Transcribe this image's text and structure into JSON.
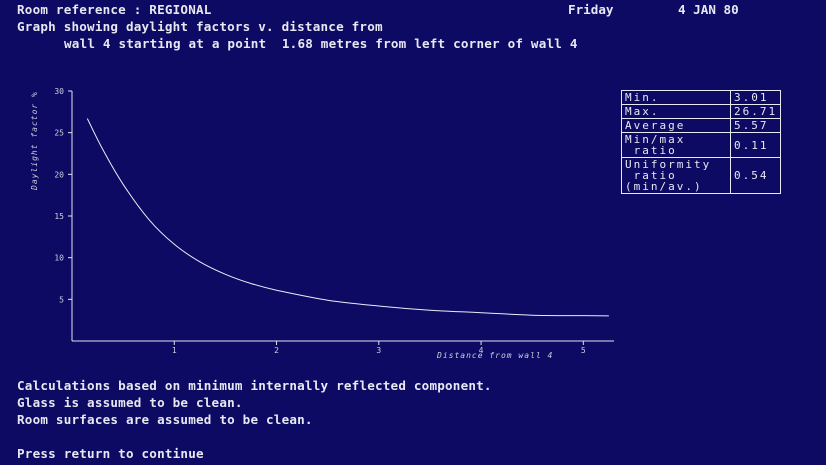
{
  "header": {
    "room_reference": "Room reference : REGIONAL",
    "day": "Friday",
    "date": "4 JAN 80",
    "line2": "Graph showing daylight factors v. distance from",
    "line3": "wall 4 starting at a point  1.68 metres from left corner of wall 4"
  },
  "chart_data": {
    "type": "line",
    "ylabel": "Daylight factor %",
    "xlabel": "Distance from wall 4",
    "xlim": [
      0,
      5.3
    ],
    "ylim": [
      0,
      30
    ],
    "x_ticks": [
      1,
      2,
      3,
      4,
      5
    ],
    "y_ticks": [
      5,
      10,
      15,
      20,
      25,
      30
    ],
    "series": [
      {
        "x": [
          0.15,
          0.3,
          0.5,
          0.75,
          1.0,
          1.25,
          1.5,
          1.75,
          2.0,
          2.5,
          3.0,
          3.5,
          4.0,
          4.5,
          5.0,
          5.25
        ],
        "y": [
          26.7,
          23.0,
          18.8,
          14.6,
          11.6,
          9.5,
          8.0,
          6.9,
          6.1,
          4.9,
          4.2,
          3.7,
          3.4,
          3.1,
          3.05,
          3.01
        ]
      }
    ]
  },
  "stats": [
    {
      "label": "Min.",
      "value": "3.01"
    },
    {
      "label": "Max.",
      "value": "26.71"
    },
    {
      "label": "Average",
      "value": "5.57"
    },
    {
      "label": "Min/max\n ratio",
      "value": "0.11"
    },
    {
      "label": "Uniformity\n ratio\n(min/av.)",
      "value": "0.54"
    }
  ],
  "footer": {
    "line1": "Calculations based on minimum internally reflected component.",
    "line2": "Glass is assumed to be clean.",
    "line3": "Room surfaces are assumed to be clean.",
    "prompt": "Press return to continue"
  }
}
